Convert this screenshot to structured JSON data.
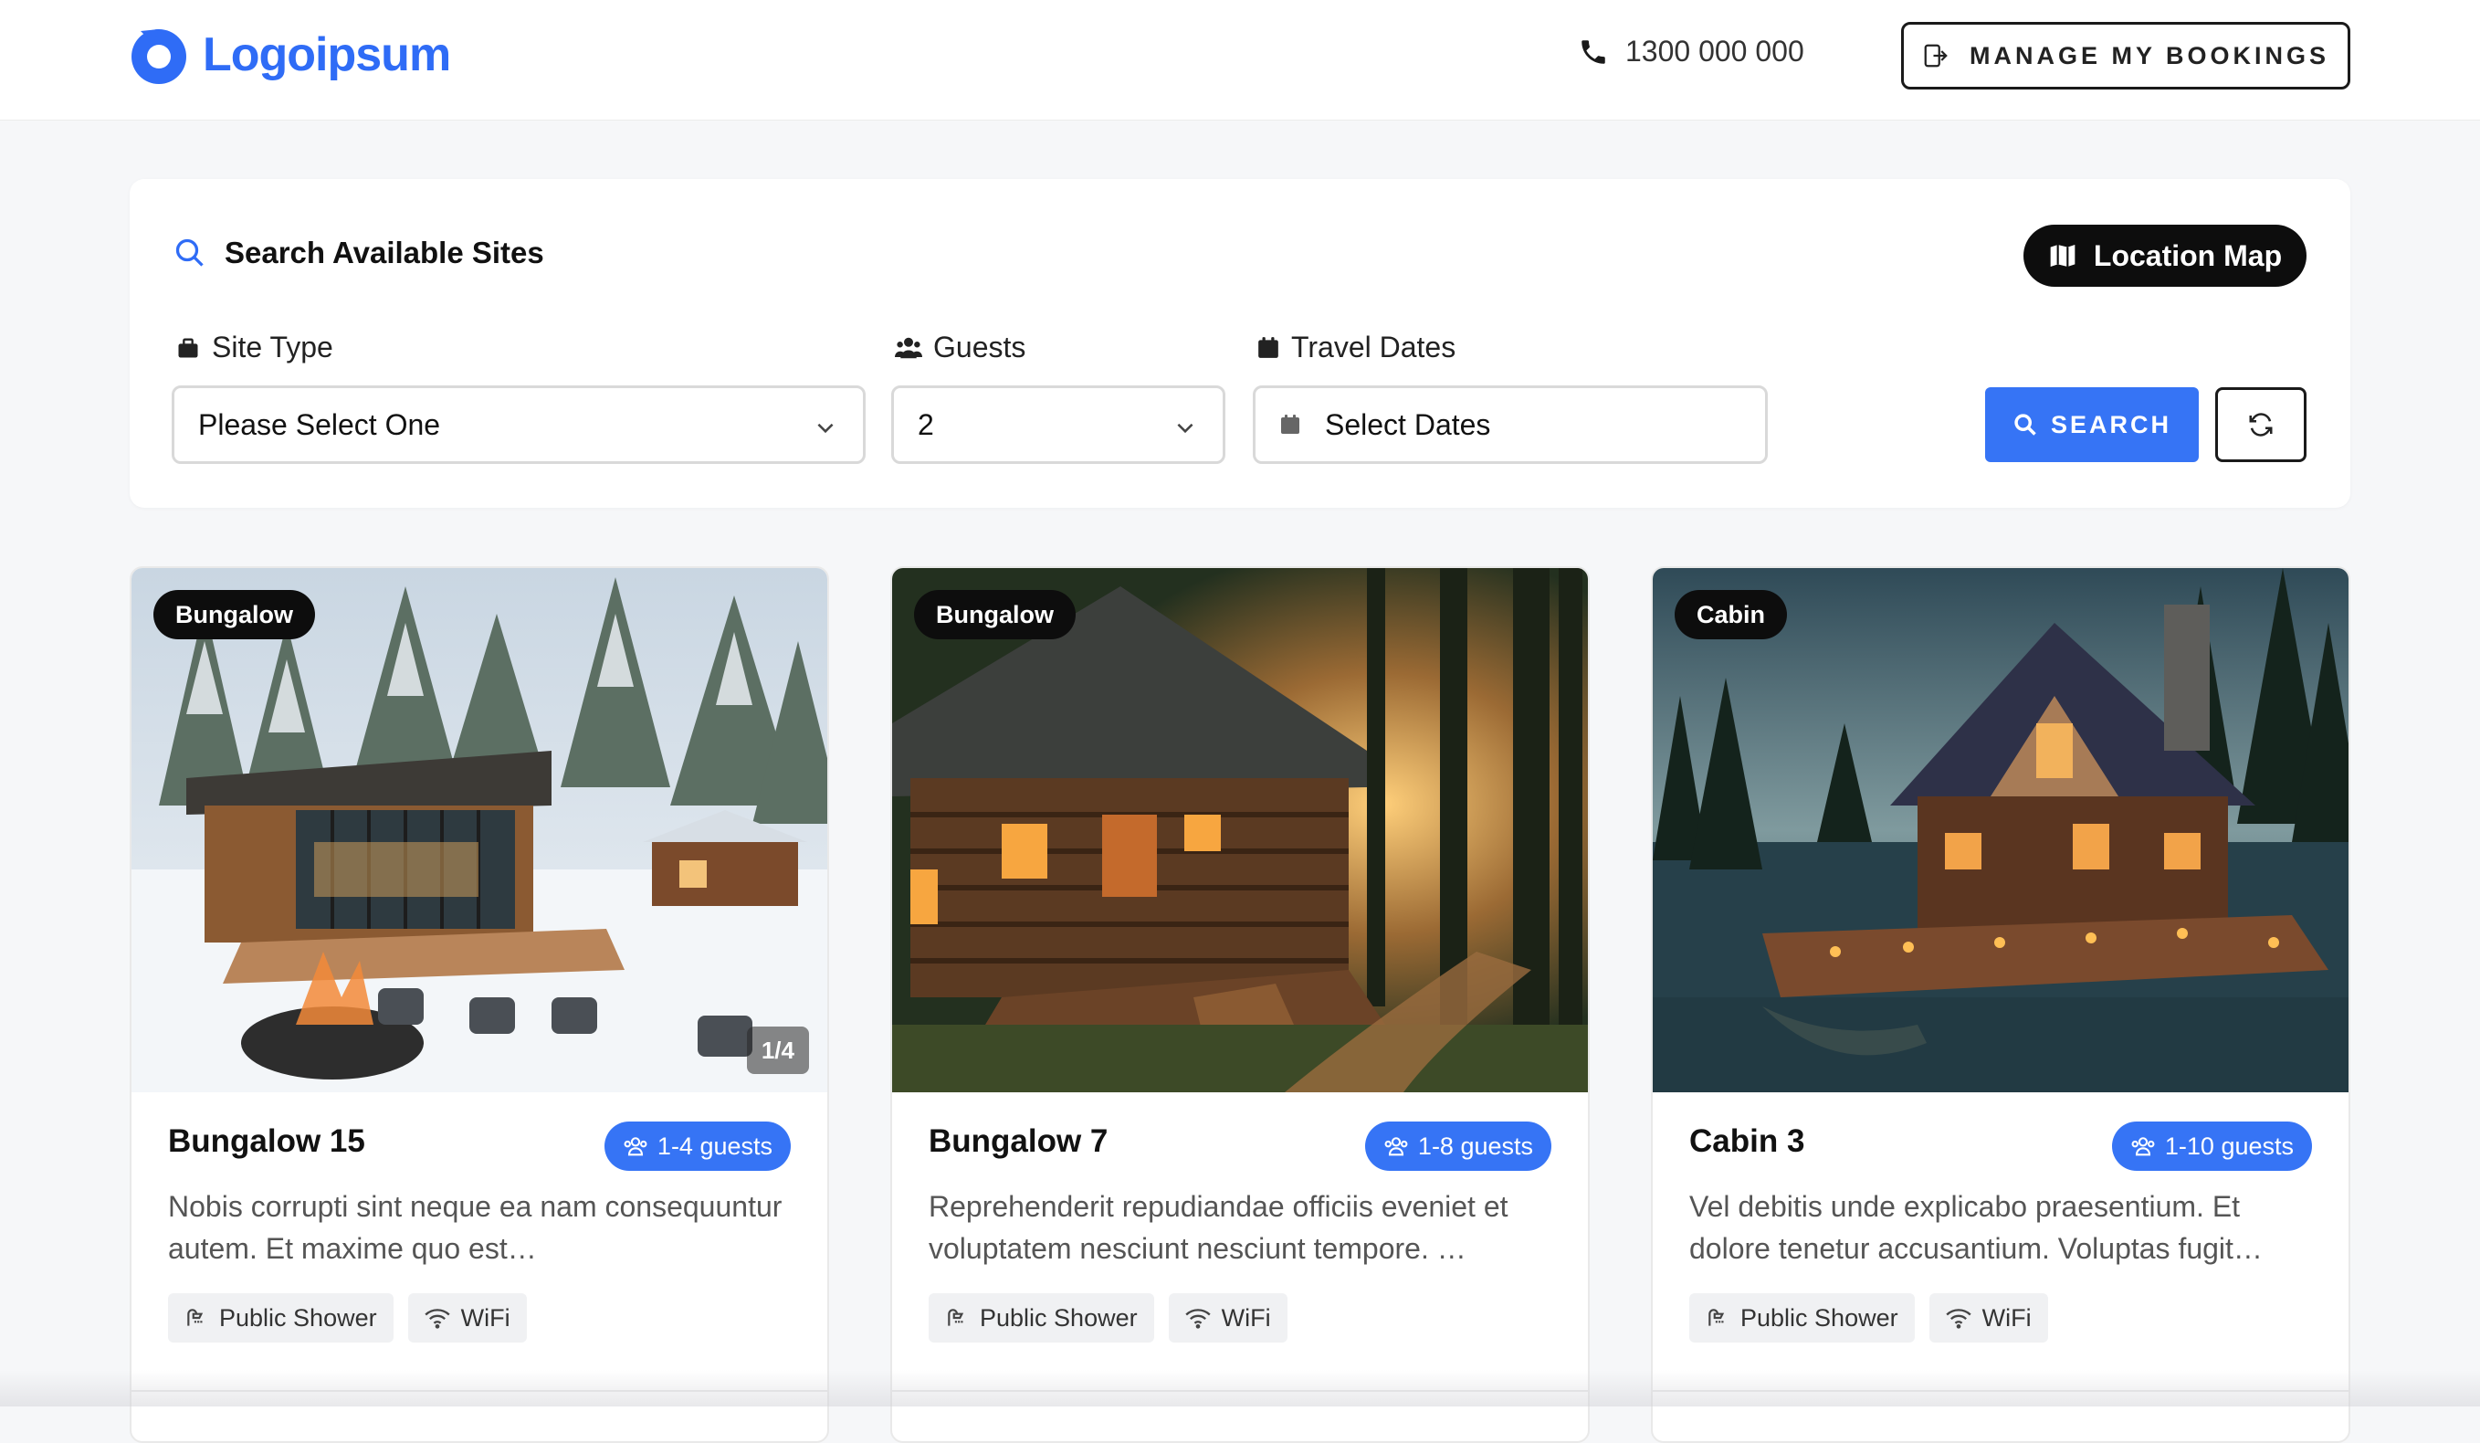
{
  "header": {
    "logo_text": "Logoipsum",
    "phone": "1300 000 000",
    "manage_label": "MANAGE MY BOOKINGS"
  },
  "search": {
    "title": "Search Available Sites",
    "map_button": "Location Map",
    "site_type": {
      "label": "Site Type",
      "value": "Please Select One"
    },
    "guests": {
      "label": "Guests",
      "value": "2"
    },
    "dates": {
      "label": "Travel Dates",
      "value": "Select Dates"
    },
    "search_button": "SEARCH"
  },
  "cards": [
    {
      "type": "Bungalow",
      "title": "Bungalow 15",
      "guests": "1-4 guests",
      "description": "Nobis corrupti sint neque ea nam consequuntur autem. Et maxime quo est…",
      "counter": "1/4",
      "amenities": [
        "Public Shower",
        "WiFi"
      ]
    },
    {
      "type": "Bungalow",
      "title": "Bungalow 7",
      "guests": "1-8 guests",
      "description": "Reprehenderit repudiandae officiis eveniet et voluptatem nesciunt nesciunt tempore. …",
      "amenities": [
        "Public Shower",
        "WiFi"
      ]
    },
    {
      "type": "Cabin",
      "title": "Cabin 3",
      "guests": "1-10 guests",
      "description": "Vel debitis unde explicabo praesentium. Et dolore tenetur accusantium. Voluptas fugit…",
      "amenities": [
        "Public Shower",
        "WiFi"
      ]
    }
  ],
  "colors": {
    "accent": "#3674f5",
    "dark": "#0d0d0d",
    "background": "#f6f7f9"
  }
}
